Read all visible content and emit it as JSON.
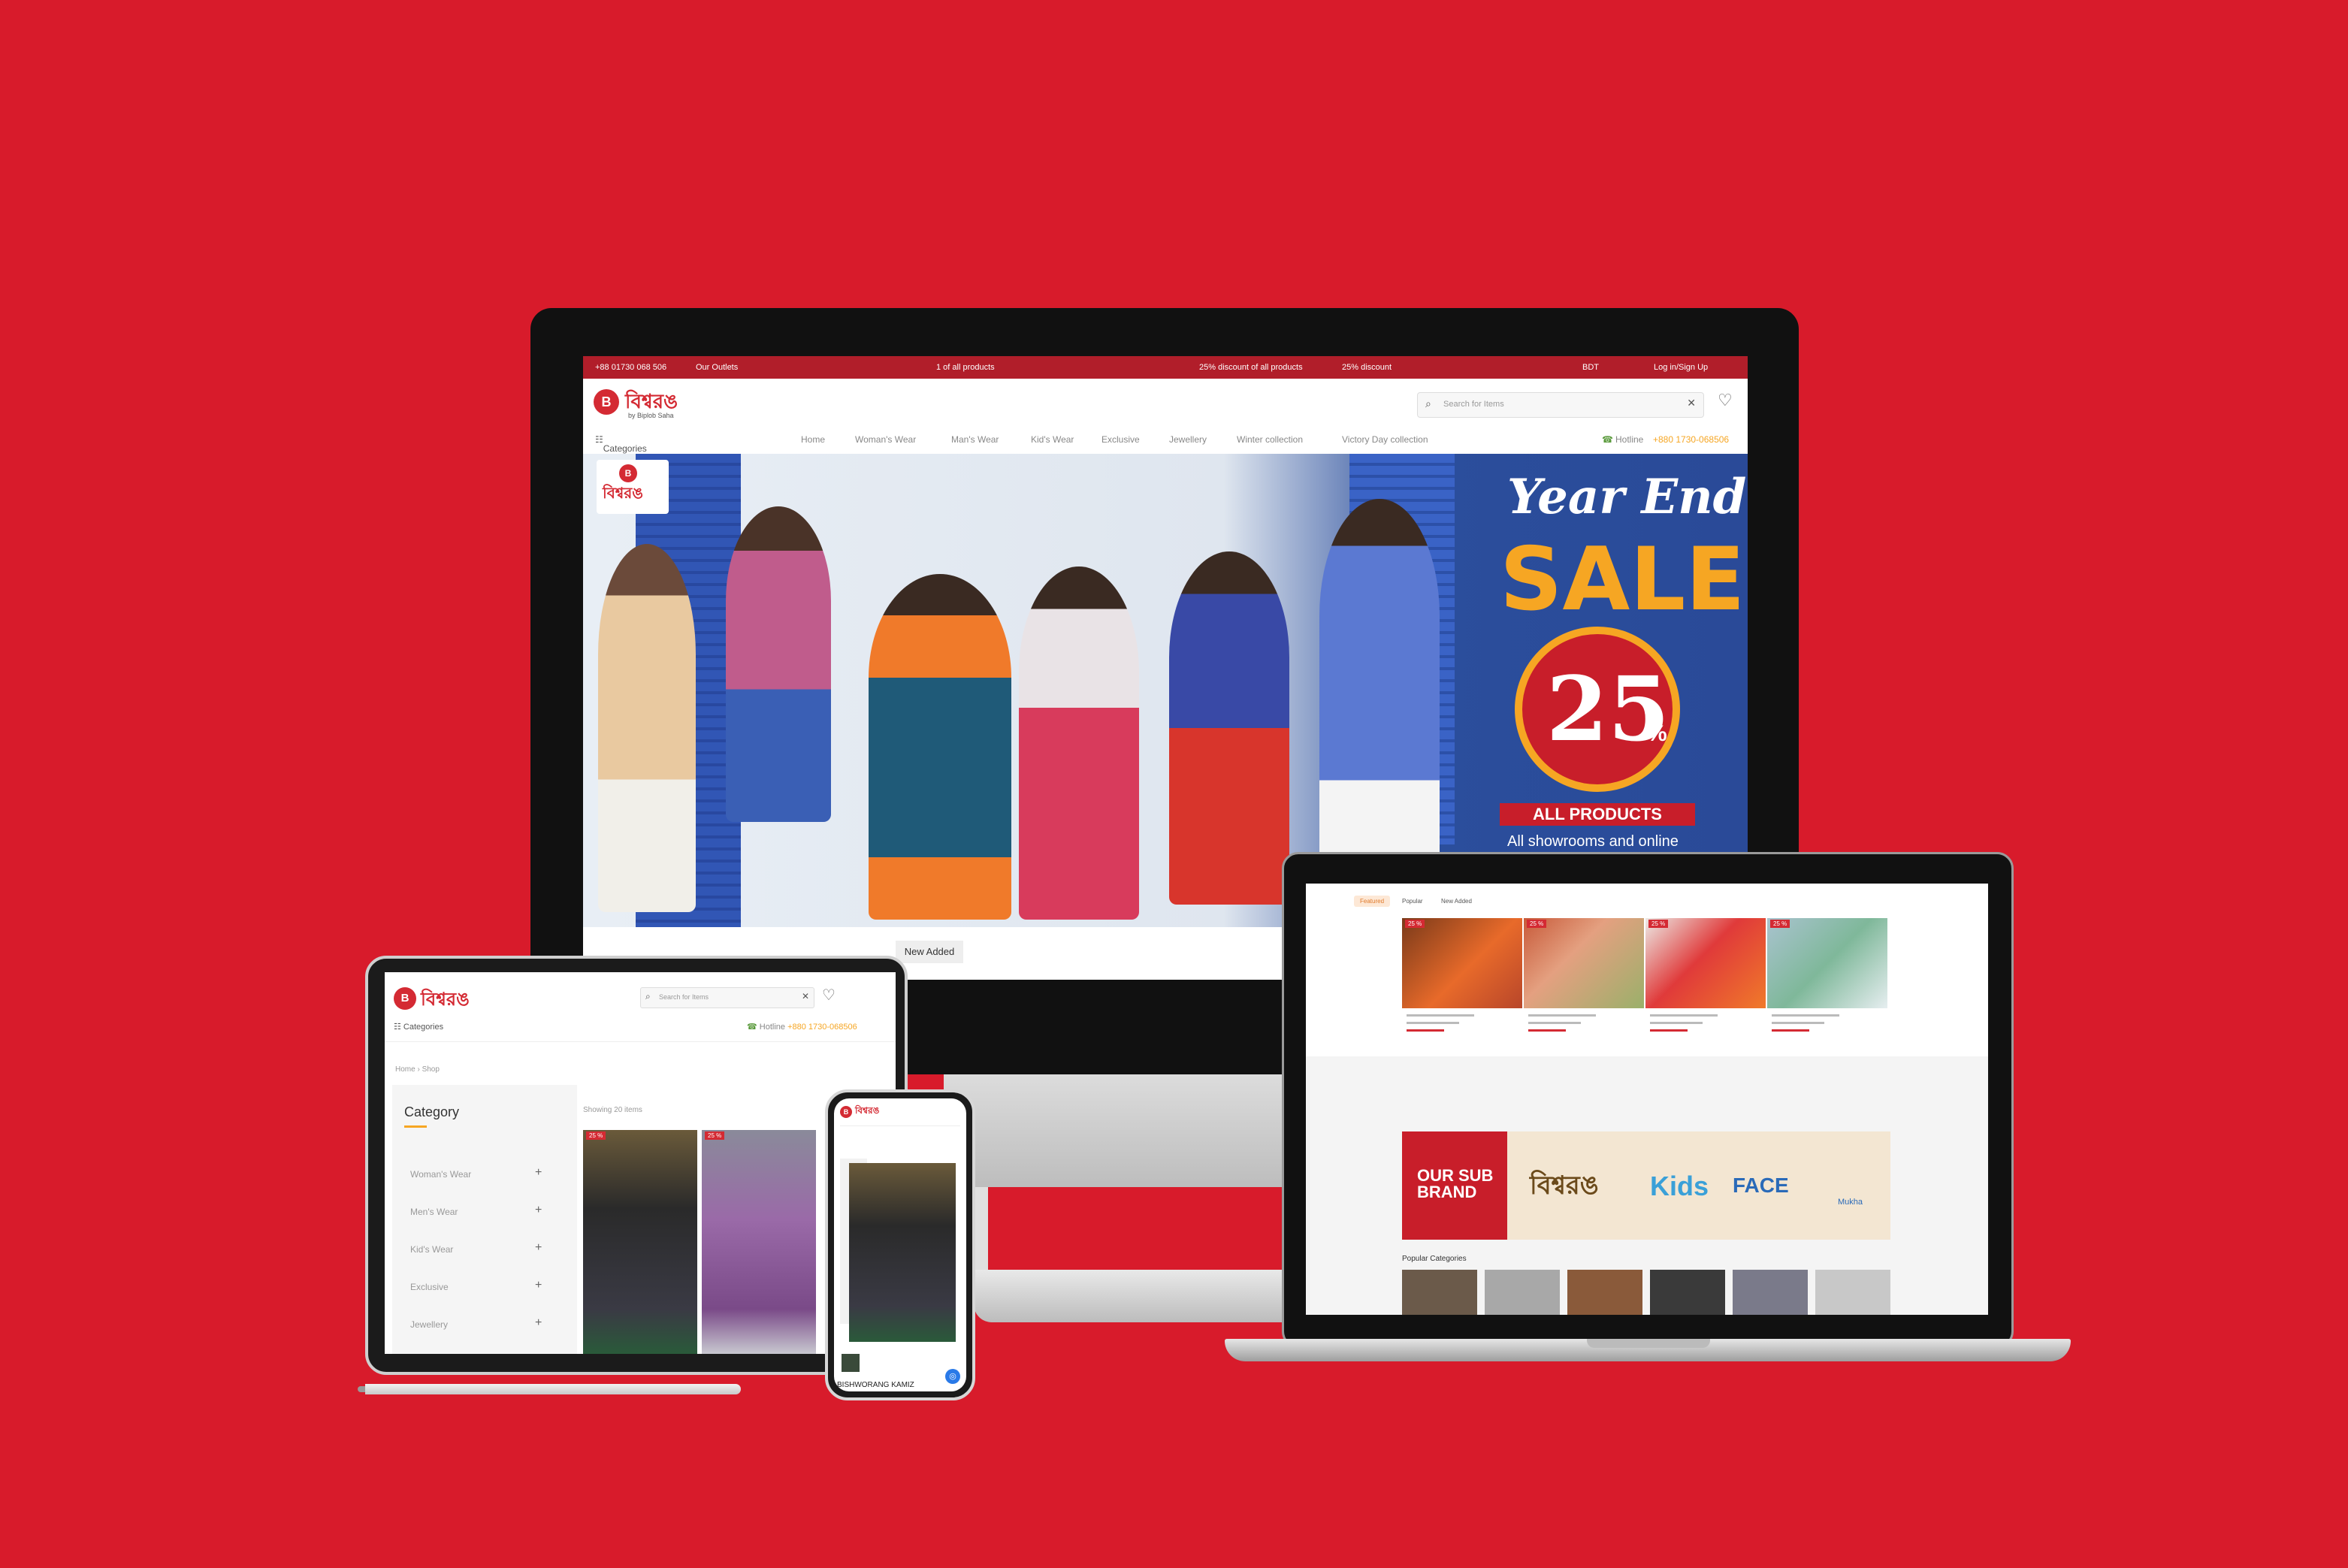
{
  "monitor": {
    "topbar": {
      "phone": "+88 01730 068 506",
      "outlets": "Our Outlets",
      "promo_center": "1 of all products",
      "promo_right1": "25% discount of all products",
      "promo_right2": "25% discount",
      "currency": "BDT",
      "login": "Log in/Sign Up"
    },
    "logo": {
      "mark": "B",
      "name": "বিশ্বরঙ",
      "sub": "by Biplob Saha"
    },
    "search": {
      "placeholder": "Search for Items"
    },
    "nav": {
      "categories": "Categories",
      "items": [
        "Home",
        "Woman's Wear",
        "Man's Wear",
        "Kid's Wear",
        "Exclusive",
        "Jewellery",
        "Winter collection",
        "Victory Day collection"
      ],
      "hotline_label": "Hotline",
      "hotline_number": "+880 1730-068506"
    },
    "hero": {
      "title1": "Year End",
      "title2": "SALE",
      "badge_value": "25",
      "badge_unit": "%",
      "ribbon": "ALL PRODUCTS",
      "footer": "All showrooms and online"
    },
    "tabs": {
      "new_added": "New Added"
    }
  },
  "laptop": {
    "tabs": [
      "Featured",
      "Popular",
      "New Added"
    ],
    "products": [
      {
        "badge": "25 %"
      },
      {
        "badge": "25 %"
      },
      {
        "badge": "25 %"
      },
      {
        "badge": "25 %"
      }
    ],
    "subbrand_title": "OUR SUB BRAND",
    "subbrands": [
      "বিশ্বরঙ",
      "Kids",
      "FACE",
      "Mukha"
    ],
    "popular_categories": "Popular Categories"
  },
  "tablet": {
    "logo_name": "বিশ্বরঙ",
    "search_placeholder": "Search for Items",
    "categories": "Categories",
    "hotline_label": "Hotline",
    "hotline_number": "+880 1730-068506",
    "breadcrumb": [
      "Home",
      "Shop"
    ],
    "sidebar_title": "Category",
    "sidebar_items": [
      "Woman's Wear",
      "Men's Wear",
      "Kid's Wear",
      "Exclusive",
      "Jewellery"
    ],
    "showing": "Showing 20 items",
    "product_badges": [
      "25 %",
      "25 %"
    ]
  },
  "phone": {
    "brand_caption": "BISHWORANG KAMIZ"
  },
  "colors": {
    "background": "#d81b2b",
    "brand_red": "#c81e2a",
    "accent_orange": "#f6a623",
    "hero_blue": "#2a4a98"
  }
}
